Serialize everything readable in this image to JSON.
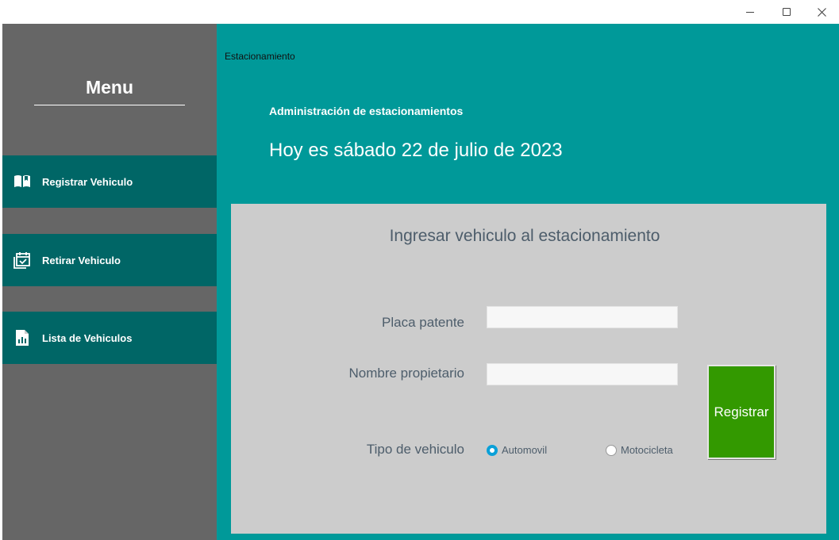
{
  "window": {
    "controls": {
      "minimize_icon": "minimize-icon",
      "maximize_icon": "maximize-icon",
      "close_icon": "close-icon"
    }
  },
  "sidebar": {
    "title": "Menu",
    "items": [
      {
        "label": "Registrar Vehiculo",
        "icon": "book-open-icon"
      },
      {
        "label": "Retirar Vehiculo",
        "icon": "calendar-check-icon"
      },
      {
        "label": "Lista de Vehiculos",
        "icon": "report-document-icon"
      }
    ]
  },
  "header": {
    "app_label": "Estacionamiento",
    "admin_title": "Administración de estacionamientos",
    "date_text": "Hoy es sábado 22 de julio de 2023"
  },
  "form": {
    "title": "Ingresar vehiculo al estacionamiento",
    "placa_label": "Placa patente",
    "placa_value": "",
    "nombre_label": "Nombre propietario",
    "nombre_value": "",
    "tipo_label": "Tipo de vehiculo",
    "options": [
      {
        "label": "Automovil",
        "selected": true
      },
      {
        "label": "Motocicleta",
        "selected": false
      }
    ],
    "submit_label": "Registrar"
  },
  "colors": {
    "sidebar_bg": "#666666",
    "nav_bg": "#006666",
    "main_bg": "#009999",
    "panel_bg": "#cccccc",
    "button_bg": "#339900",
    "radio_accent": "#0aa0d8"
  }
}
